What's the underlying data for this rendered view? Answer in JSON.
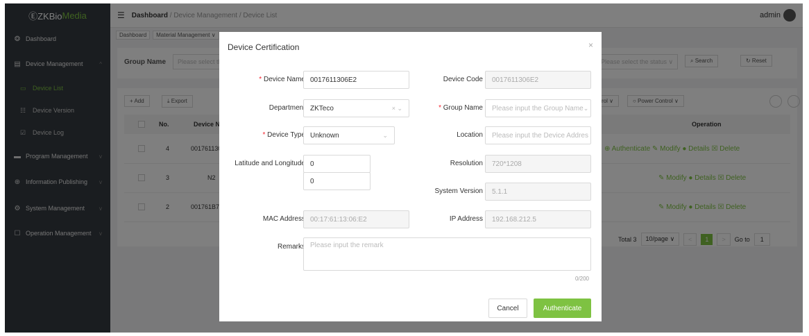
{
  "brand": {
    "prefix": "ⒺZKBio",
    "suffix": " Media"
  },
  "sidebar": {
    "items": [
      {
        "label": "Dashboard",
        "icon": "dashboard-icon",
        "glyph": "❂"
      },
      {
        "label": "Device Management",
        "icon": "device-icon",
        "glyph": "▤"
      },
      {
        "label": "Program Management",
        "icon": "program-icon",
        "glyph": "▬"
      },
      {
        "label": "Information Publishing",
        "icon": "publish-icon",
        "glyph": "⊕"
      },
      {
        "label": "System Management",
        "icon": "system-icon",
        "glyph": "⚙"
      },
      {
        "label": "Operation Management",
        "icon": "operation-icon",
        "glyph": "☐"
      }
    ],
    "subitems": [
      {
        "label": "Device List",
        "glyph": "▭"
      },
      {
        "label": "Device Version",
        "glyph": "☷"
      },
      {
        "label": "Device Log",
        "glyph": "☑"
      }
    ]
  },
  "header": {
    "breadcrumb_root": "Dashboard",
    "breadcrumb_rest": " / Device Management / Device List",
    "user": "admin"
  },
  "tags": [
    "Dashboard",
    "Material Management ∨"
  ],
  "filter": {
    "group_label": "Group Name",
    "group_placeholder": "Please select th",
    "status_placeholder": "Please select the status ∨",
    "search": "⌕ Search",
    "reset": "↻ Reset"
  },
  "toolbar": {
    "add": "+ Add",
    "export": "⤓ Export",
    "control": "rol ∨",
    "power": "○ Power Control ∨"
  },
  "table": {
    "col_no": "No.",
    "col_name": "Device Nar",
    "col_op": "Operation",
    "rows": [
      {
        "no": "4",
        "name": "001761130",
        "ops": "⊕ Authenticate  ✎ Modify  ● Details  ☒ Delete"
      },
      {
        "no": "3",
        "name": "N2",
        "ops": "✎ Modify  ● Details  ☒ Delete"
      },
      {
        "no": "2",
        "name": "001761B76",
        "ops": "✎ Modify  ● Details  ☒ Delete"
      }
    ]
  },
  "pagination": {
    "total": "Total 3",
    "size": "10/page ∨",
    "page": "1",
    "goto": "Go to",
    "goto_val": "1"
  },
  "modal": {
    "title": "Device Certification",
    "close": "×",
    "device_name_label": "Device Name",
    "device_name_value": "0017611306E2",
    "device_code_label": "Device Code",
    "device_code_value": "0017611306E2",
    "department_label": "Department",
    "department_value": "ZKTeco",
    "group_name_label": "Group Name",
    "group_name_placeholder": "Please input the Group Name",
    "device_type_label": "Device Type",
    "device_type_value": "Unknown",
    "location_label": "Location",
    "location_placeholder": "Please input the Device Addres",
    "latlng_label": "Latitude and Longitude",
    "lat_value": "0",
    "lng_value": "0",
    "resolution_label": "Resolution",
    "resolution_value": "720*1208",
    "system_version_label": "System Version",
    "system_version_value": "5.1.1",
    "mac_label": "MAC Address",
    "mac_value": "00:17:61:13:06:E2",
    "ip_label": "IP Address",
    "ip_value": "192.168.212.5",
    "remarks_label": "Remarks",
    "remarks_placeholder": "Please input the remark",
    "remarks_counter": "0/200",
    "cancel": "Cancel",
    "authenticate": "Authenticate"
  },
  "colors": {
    "accent": "#7ec242",
    "sidebar": "#343a40",
    "required": "#f5222d"
  }
}
